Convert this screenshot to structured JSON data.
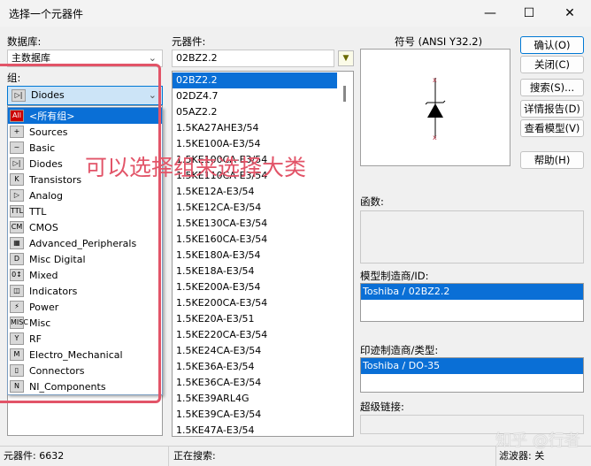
{
  "window": {
    "title": "选择一个元器件",
    "minimize": "—",
    "maximize": "☐",
    "close": "✕"
  },
  "database": {
    "label": "数据库:",
    "value": "主数据库"
  },
  "group": {
    "label": "组:",
    "value": "Diodes",
    "options": [
      "<所有组>",
      "Sources",
      "Basic",
      "Diodes",
      "Transistors",
      "Analog",
      "TTL",
      "CMOS",
      "Advanced_Peripherals",
      "Misc Digital",
      "Mixed",
      "Indicators",
      "Power",
      "Misc",
      "RF",
      "Electro_Mechanical",
      "Connectors",
      "NI_Components"
    ],
    "icons": [
      "All",
      "+",
      "~",
      "▷|",
      "K",
      "▷",
      "TTL",
      "CM",
      "▦",
      "D",
      "0↕",
      "◫",
      "⚡",
      "MISC",
      "Y",
      "M",
      "▯",
      "N"
    ]
  },
  "component": {
    "label": "元器件:",
    "value": "02BZ2.2",
    "items": [
      "02BZ2.2",
      "02DZ4.7",
      "05AZ2.2",
      "1.5KA27AHE3/54",
      "1.5KE100A-E3/54",
      "1.5KE100CA-E3/54",
      "1.5KE110CA-E3/54",
      "1.5KE12A-E3/54",
      "1.5KE12CA-E3/54",
      "1.5KE130CA-E3/54",
      "1.5KE160CA-E3/54",
      "1.5KE180A-E3/54",
      "1.5KE18A-E3/54",
      "1.5KE200A-E3/54",
      "1.5KE200CA-E3/54",
      "1.5KE20A-E3/51",
      "1.5KE220CA-E3/54",
      "1.5KE24CA-E3/54",
      "1.5KE36A-E3/54",
      "1.5KE36CA-E3/54",
      "1.5KE39ARL4G",
      "1.5KE39CA-E3/54",
      "1.5KE47A-E3/54"
    ]
  },
  "symbol": {
    "label": "符号 (ANSI Y32.2)"
  },
  "buttons": {
    "ok": "确认(O)",
    "close": "关闭(C)",
    "search": "搜索(S)...",
    "detail": "详情报告(D)",
    "model": "查看模型(V)",
    "help": "帮助(H)"
  },
  "function": {
    "label": "函数:"
  },
  "model_mfr": {
    "label": "模型制造商/ID:",
    "value": "Toshiba / 02BZ2.2"
  },
  "footprint": {
    "label": "印迹制造商/类型:",
    "value": "Toshiba / DO-35"
  },
  "hyperlink": {
    "label": "超级链接:"
  },
  "status": {
    "count": "元器件: 6632",
    "searching": "正在搜索:",
    "filter": "滤波器: 关"
  },
  "annotation": "可以选择组来选择大类",
  "watermark": "知乎 @行者"
}
